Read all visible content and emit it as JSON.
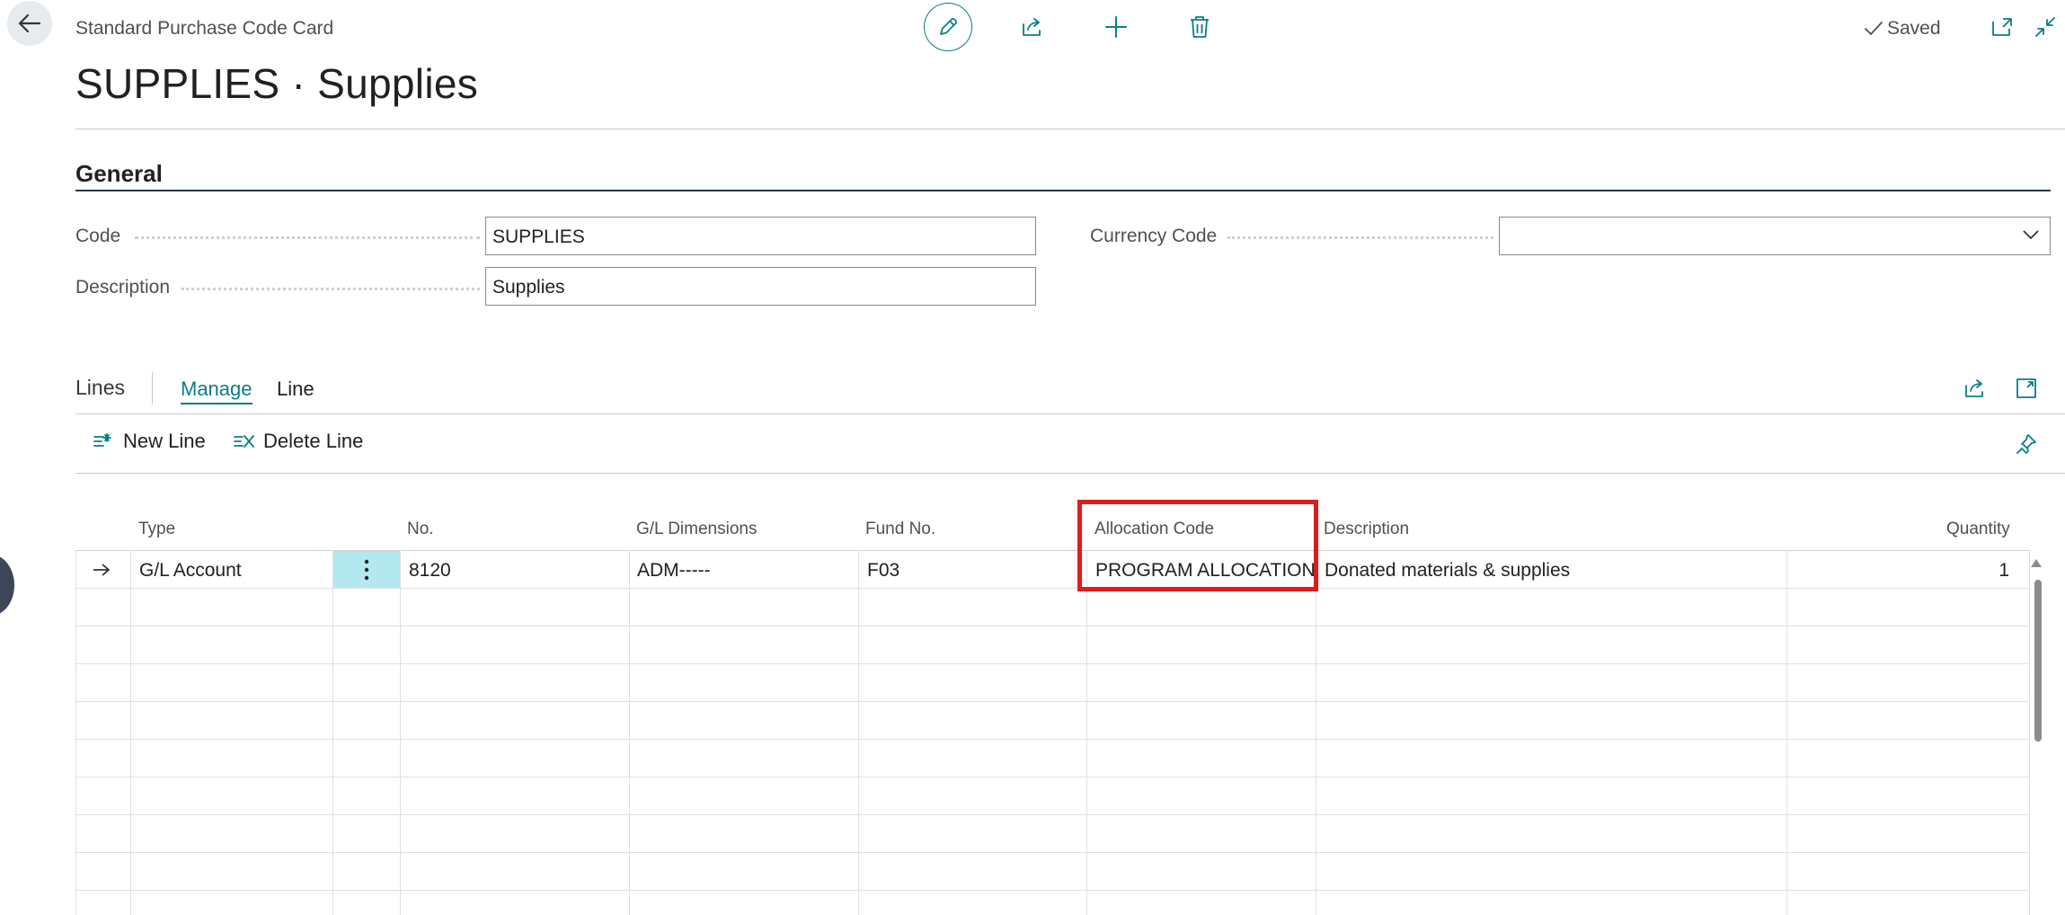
{
  "header": {
    "breadcrumb": "Standard Purchase Code Card",
    "title": "SUPPLIES · Supplies",
    "saved_label": "Saved",
    "actions": [
      "edit-icon",
      "share-icon",
      "add-icon",
      "delete-icon"
    ]
  },
  "general": {
    "section_title": "General",
    "code_label": "Code",
    "code_value": "SUPPLIES",
    "description_label": "Description",
    "description_value": "Supplies",
    "currency_label": "Currency Code",
    "currency_value": ""
  },
  "lines": {
    "title": "Lines",
    "tabs": [
      "Manage",
      "Line"
    ],
    "toolbar": {
      "new_line": "New Line",
      "delete_line": "Delete Line"
    },
    "columns": {
      "type": "Type",
      "no": "No.",
      "gl_dimensions": "G/L Dimensions",
      "fund_no": "Fund No.",
      "allocation_code": "Allocation Code",
      "description": "Description",
      "quantity": "Quantity"
    },
    "rows": [
      {
        "type": "G/L Account",
        "no": "8120",
        "gl_dimensions": "ADM-----",
        "fund_no": "F03",
        "allocation_code": "PROGRAM ALLOCATION",
        "description": "Donated materials & supplies",
        "quantity": "1"
      }
    ]
  },
  "colors": {
    "accent": "#0a7e86",
    "highlight": "#e01b1b",
    "section_rule": "#2b3550",
    "row_menu_bg": "#b3e8ee"
  }
}
